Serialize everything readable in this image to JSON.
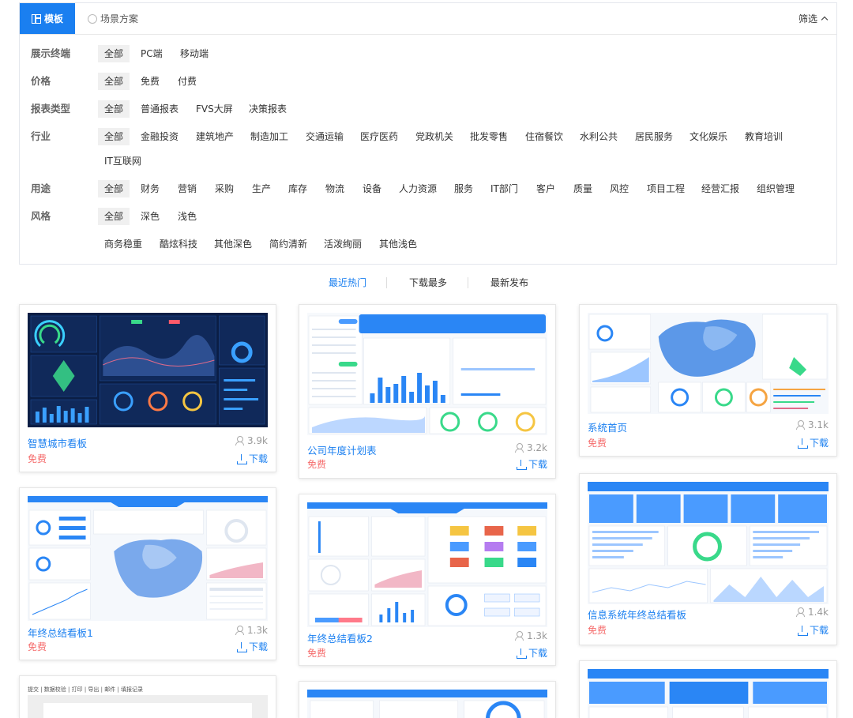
{
  "tabs": [
    {
      "label": "模板",
      "icon": "grid-icon"
    },
    {
      "label": "场景方案",
      "icon": "lightbulb-icon"
    }
  ],
  "filter_toggle": {
    "label": "筛选",
    "icon": "chevron-up-icon"
  },
  "filters": [
    {
      "label": "展示终端",
      "options": [
        "全部",
        "PC端",
        "移动端"
      ]
    },
    {
      "label": "价格",
      "options": [
        "全部",
        "免费",
        "付费"
      ]
    },
    {
      "label": "报表类型",
      "options": [
        "全部",
        "普通报表",
        "FVS大屏",
        "决策报表"
      ]
    },
    {
      "label": "行业",
      "options": [
        "全部",
        "金融投资",
        "建筑地产",
        "制造加工",
        "交通运输",
        "医疗医药",
        "党政机关",
        "批发零售",
        "住宿餐饮",
        "水利公共",
        "居民服务",
        "文化娱乐",
        "教育培训",
        "IT互联网"
      ]
    },
    {
      "label": "用途",
      "options": [
        "全部",
        "财务",
        "营销",
        "采购",
        "生产",
        "库存",
        "物流",
        "设备",
        "人力资源",
        "服务",
        "IT部门",
        "客户",
        "质量",
        "风控",
        "项目工程",
        "经营汇报",
        "组织管理"
      ]
    },
    {
      "label": "风格",
      "options": [
        "全部",
        "深色",
        "浅色"
      ],
      "sub_options": [
        "商务稳重",
        "酷炫科技",
        "其他深色",
        "简约清新",
        "活泼绚丽",
        "其他浅色"
      ]
    }
  ],
  "sort": [
    "最近热门",
    "下载最多",
    "最新发布"
  ],
  "cards": [
    {
      "title": "智慧城市看板",
      "price": "免费",
      "views": "3.9k",
      "download": "下载",
      "theme": "dark"
    },
    {
      "title": "公司年度计划表",
      "price": "免费",
      "views": "3.2k",
      "download": "下载",
      "theme": "light"
    },
    {
      "title": "系统首页",
      "price": "免费",
      "views": "3.1k",
      "download": "下载",
      "theme": "light"
    },
    {
      "title": "年终总结看板1",
      "price": "免费",
      "views": "1.3k",
      "download": "下载",
      "theme": "light"
    },
    {
      "title": "年终总结看板2",
      "price": "免费",
      "views": "1.3k",
      "download": "下载",
      "theme": "light"
    },
    {
      "title": "信息系统年终总结看板",
      "price": "免费",
      "views": "1.4k",
      "download": "下载",
      "theme": "light"
    }
  ],
  "partial_cards": [
    {
      "toolbar_text": "提交 | 数据校验 | 打印 | 导出 | 邮件 | 填报记录"
    }
  ],
  "colors": {
    "accent": "#1a7ff0",
    "price": "#f56c6c",
    "selected_bg": "#f0f0f0",
    "dark_thumb": "#0b1e45"
  }
}
